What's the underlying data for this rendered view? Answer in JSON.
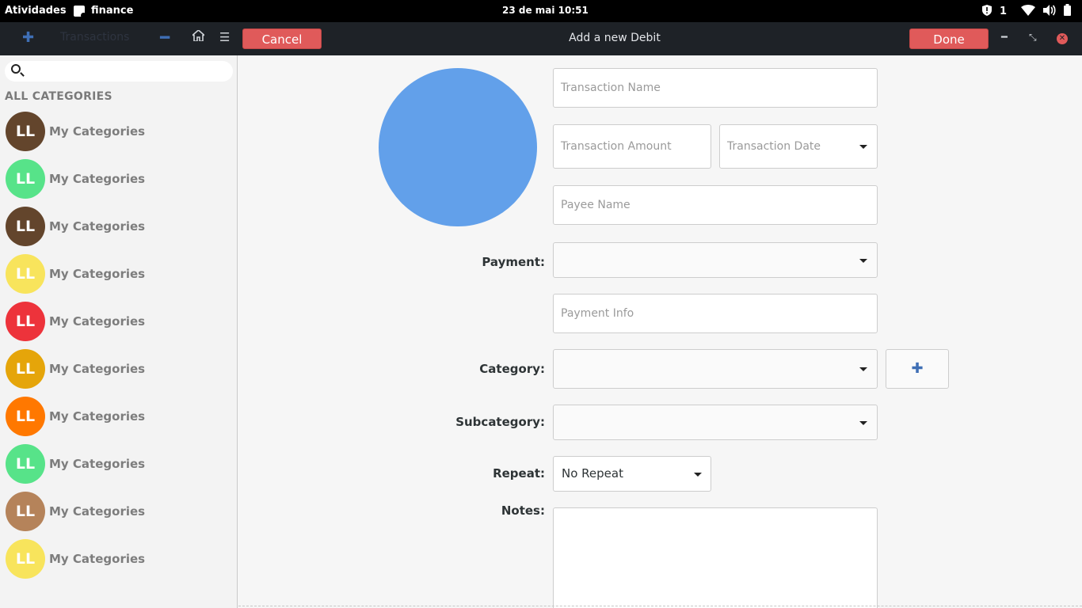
{
  "system_bar": {
    "activities": "Atividades",
    "app_name": "finance",
    "clock": "23 de mai  10:51",
    "notification_count": "1",
    "icons": [
      "shield-icon",
      "wifi-icon",
      "volume-icon",
      "battery-icon"
    ]
  },
  "header": {
    "left_title": "Transactions",
    "cancel_label": "Cancel",
    "title": "Add a new Debit",
    "done_label": "Done",
    "accent_color": "#e05a5a"
  },
  "sidebar": {
    "search_placeholder": "",
    "section_title": "ALL CATEGORIES",
    "categories": [
      {
        "initials": "LL",
        "label": "My Categories",
        "color": "#63452c"
      },
      {
        "initials": "LL",
        "label": "My Categories",
        "color": "#57e389"
      },
      {
        "initials": "LL",
        "label": "My Categories",
        "color": "#63452c"
      },
      {
        "initials": "LL",
        "label": "My Categories",
        "color": "#f8e45c"
      },
      {
        "initials": "LL",
        "label": "My Categories",
        "color": "#ed333b"
      },
      {
        "initials": "LL",
        "label": "My Categories",
        "color": "#e5a50a"
      },
      {
        "initials": "LL",
        "label": "My Categories",
        "color": "#ff7800"
      },
      {
        "initials": "LL",
        "label": "My Categories",
        "color": "#57e389"
      },
      {
        "initials": "LL",
        "label": "My Categories",
        "color": "#b5835a"
      },
      {
        "initials": "LL",
        "label": "My Categories",
        "color": "#f8e45c"
      }
    ]
  },
  "form": {
    "avatar_color": "#62a0ea",
    "transaction_name_placeholder": "Transaction Name",
    "transaction_amount_placeholder": "Transaction Amount",
    "transaction_date_placeholder": "Transaction Date",
    "payee_name_placeholder": "Payee Name",
    "payment_label": "Payment:",
    "payment_info_placeholder": "Payment Info",
    "category_label": "Category:",
    "subcategory_label": "Subcategory:",
    "repeat_label": "Repeat:",
    "repeat_value": "No Repeat",
    "notes_label": "Notes:"
  }
}
